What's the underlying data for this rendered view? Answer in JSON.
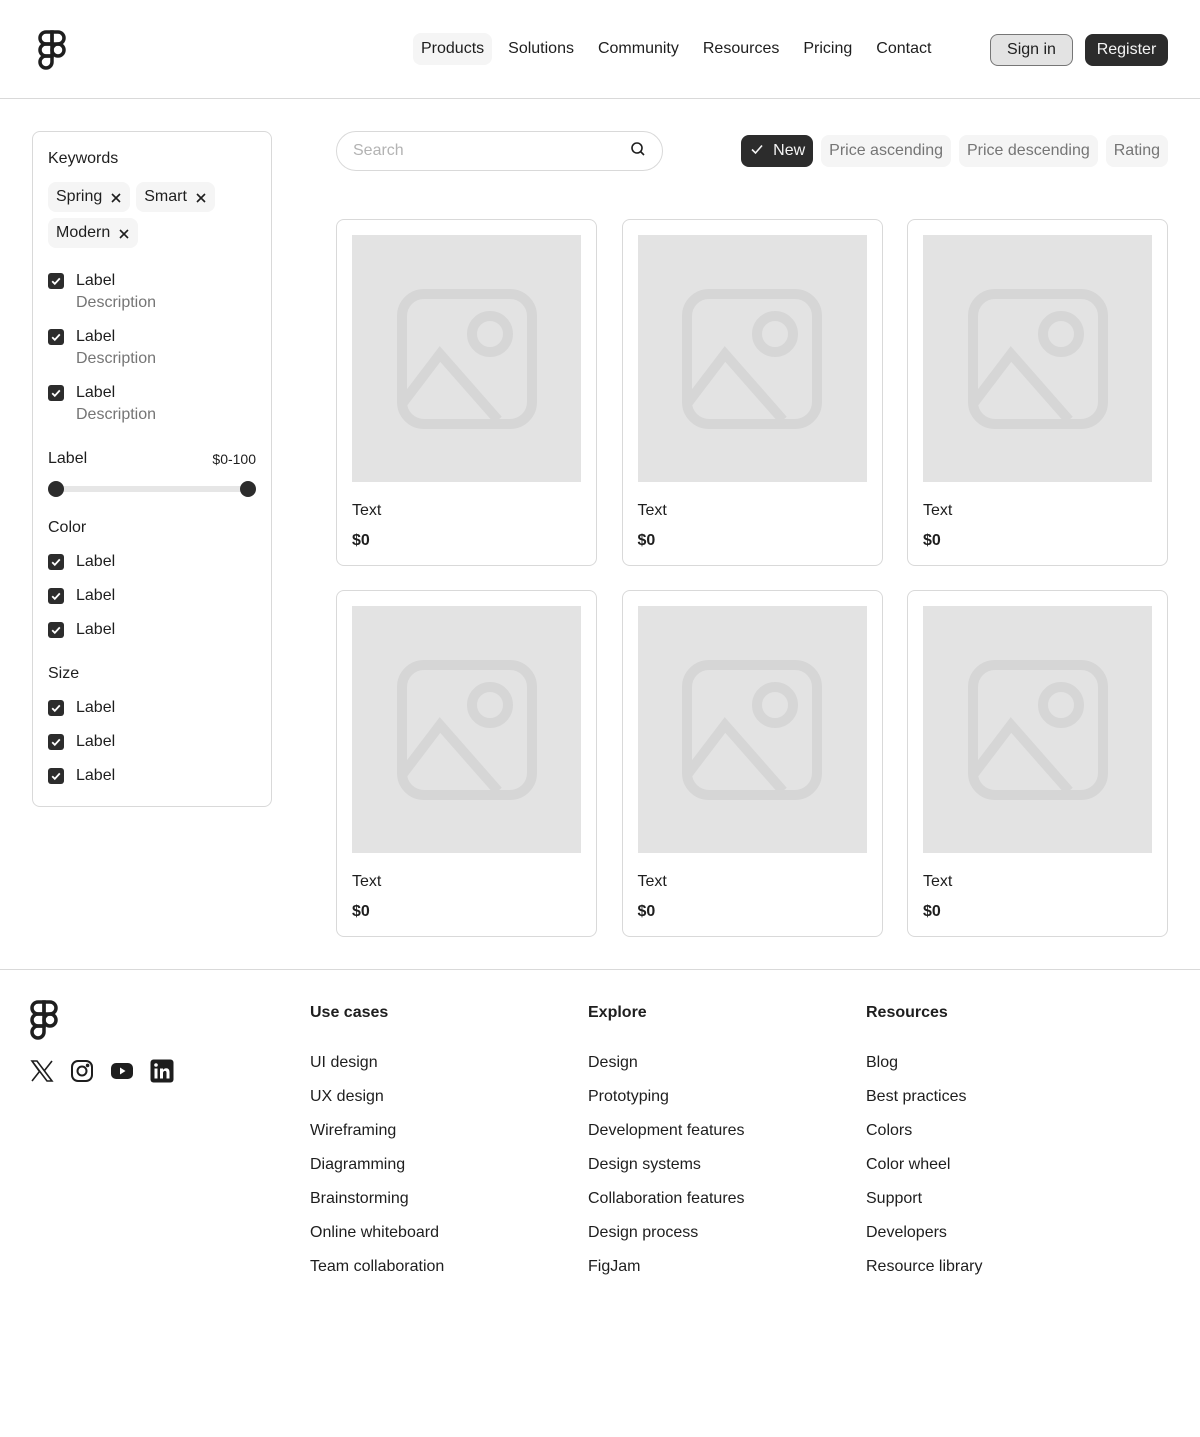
{
  "header": {
    "logo_icon": "figma-logo-icon",
    "nav": [
      {
        "label": "Products",
        "active": true
      },
      {
        "label": "Solutions"
      },
      {
        "label": "Community"
      },
      {
        "label": "Resources"
      },
      {
        "label": "Pricing"
      },
      {
        "label": "Contact"
      }
    ],
    "sign_in": "Sign in",
    "register": "Register"
  },
  "sidebar": {
    "keywords_title": "Keywords",
    "tags": [
      "Spring",
      "Smart",
      "Modern"
    ],
    "checklist": [
      {
        "label": "Label",
        "description": "Description",
        "checked": true
      },
      {
        "label": "Label",
        "description": "Description",
        "checked": true
      },
      {
        "label": "Label",
        "description": "Description",
        "checked": true
      }
    ],
    "range": {
      "label": "Label",
      "value": "$0-100",
      "min": 0,
      "max": 100
    },
    "color": {
      "title": "Color",
      "items": [
        "Label",
        "Label",
        "Label"
      ]
    },
    "size": {
      "title": "Size",
      "items": [
        "Label",
        "Label",
        "Label"
      ]
    }
  },
  "search": {
    "placeholder": "Search",
    "icon": "search-icon"
  },
  "sort_chips": [
    {
      "label": "New",
      "active": true
    },
    {
      "label": "Price ascending"
    },
    {
      "label": "Price descending"
    },
    {
      "label": "Rating"
    }
  ],
  "products": [
    {
      "name": "Text",
      "price": "$0",
      "image_icon": "image-placeholder-icon"
    },
    {
      "name": "Text",
      "price": "$0",
      "image_icon": "image-placeholder-icon"
    },
    {
      "name": "Text",
      "price": "$0",
      "image_icon": "image-placeholder-icon"
    },
    {
      "name": "Text",
      "price": "$0",
      "image_icon": "image-placeholder-icon"
    },
    {
      "name": "Text",
      "price": "$0",
      "image_icon": "image-placeholder-icon"
    },
    {
      "name": "Text",
      "price": "$0",
      "image_icon": "image-placeholder-icon"
    }
  ],
  "footer": {
    "socials": [
      "x-icon",
      "instagram-icon",
      "youtube-icon",
      "linkedin-icon"
    ],
    "columns": [
      {
        "title": "Use cases",
        "links": [
          "UI design",
          "UX design",
          "Wireframing",
          "Diagramming",
          "Brainstorming",
          "Online whiteboard",
          "Team collaboration"
        ]
      },
      {
        "title": "Explore",
        "links": [
          "Design",
          "Prototyping",
          "Development features",
          "Design systems",
          "Collaboration features",
          "Design process",
          "FigJam"
        ]
      },
      {
        "title": "Resources",
        "links": [
          "Blog",
          "Best practices",
          "Colors",
          "Color wheel",
          "Support",
          "Developers",
          "Resource library"
        ]
      }
    ]
  },
  "colors": {
    "primary": "#2c2c2c",
    "border": "#d9d9d9",
    "muted": "#757575",
    "placeholder_bg": "#e3e3e3"
  }
}
